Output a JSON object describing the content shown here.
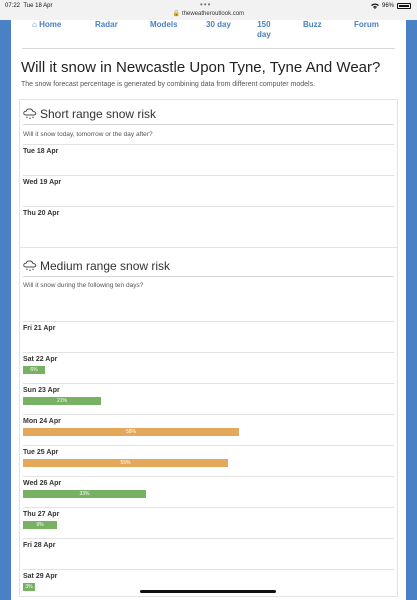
{
  "status_bar": {
    "time": "07:22",
    "date": "Tue 18 Apr",
    "battery": "96%"
  },
  "browser": {
    "url": "theweatheroutlook.com"
  },
  "nav": {
    "home": "Home",
    "radar": "Radar",
    "models": "Models",
    "day30": "30 day",
    "day150_line1": "150",
    "day150_line2": "day",
    "buzz": "Buzz",
    "forum": "Forum"
  },
  "page": {
    "title": "Will it snow in Newcastle Upon Tyne, Tyne And Wear?",
    "intro": "The snow forecast percentage is generated by combining data from different computer models."
  },
  "short_range": {
    "title": "Short range snow risk",
    "question": "Will it snow today, tomorrow or the day after?",
    "days": [
      {
        "label": "Tue 18 Apr"
      },
      {
        "label": "Wed 19 Apr"
      },
      {
        "label": "Thu 20 Apr"
      }
    ]
  },
  "medium_range": {
    "title": "Medium range snow risk",
    "question": "Will it snow during the following ten days?",
    "days": [
      {
        "label": "Fri 21 Apr",
        "percent": null,
        "percent_label": "",
        "level": "none"
      },
      {
        "label": "Sat 22 Apr",
        "percent": 6,
        "percent_label": "6%",
        "level": "low"
      },
      {
        "label": "Sun 23 Apr",
        "percent": 21,
        "percent_label": "21%",
        "level": "low"
      },
      {
        "label": "Mon 24 Apr",
        "percent": 58,
        "percent_label": "58%",
        "level": "medium"
      },
      {
        "label": "Tue 25 Apr",
        "percent": 55,
        "percent_label": "55%",
        "level": "medium"
      },
      {
        "label": "Wed 26 Apr",
        "percent": 33,
        "percent_label": "33%",
        "level": "low"
      },
      {
        "label": "Thu 27 Apr",
        "percent": 9,
        "percent_label": "9%",
        "level": "low"
      },
      {
        "label": "Fri 28 Apr",
        "percent": null,
        "percent_label": "",
        "level": "none"
      },
      {
        "label": "Sat 29 Apr",
        "percent": 3,
        "percent_label": "3%",
        "level": "low"
      }
    ]
  },
  "colors": {
    "brand_blue": "#4a80c4",
    "low": "#77b163",
    "medium": "#e3a85a"
  },
  "icons": {
    "nav_home": "house-icon",
    "section": "snow-cloud-icon"
  }
}
